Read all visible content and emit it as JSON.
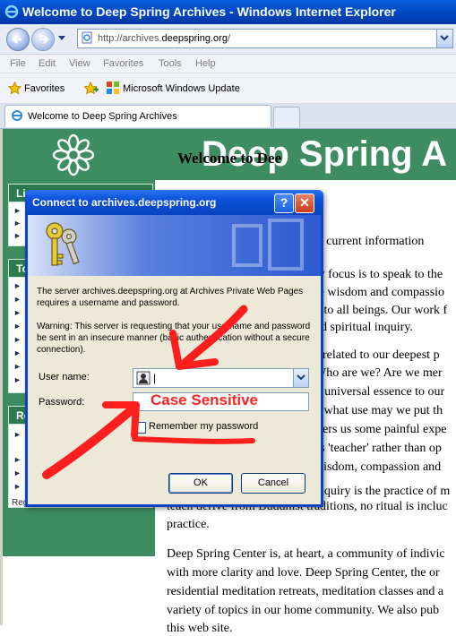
{
  "window": {
    "title": "Welcome to Deep Spring Archives - Windows Internet Explorer"
  },
  "address_bar": {
    "url_prefix": "http://archives.",
    "url_domain": "deepspring.org",
    "url_suffix": "/"
  },
  "menu": [
    "File",
    "Edit",
    "View",
    "Favorites",
    "Tools",
    "Help"
  ],
  "favorites_bar": {
    "favorites_label": "Favorites",
    "link": "Microsoft Windows Update"
  },
  "tab": {
    "title": "Welcome to Deep Spring Archives"
  },
  "site": {
    "banner_title": "Deep Spring A",
    "welcome": "Welcome to Dee",
    "sidebar": {
      "heading1": "Lin",
      "heading2": "To",
      "heading3": "Re",
      "register": "Register for a Class"
    },
    "body_lines": [
      "a. For current information",
      "ry focus is to speak to the",
      "re wisdom and compassio",
      "n to all beings. Our work f",
      "nd spiritual inquiry.",
      "s related to our deepest p",
      "Who are we? Are we mer",
      "r, universal essence to our",
      "o what use may we put th",
      "ffers us some painful expe",
      "as 'teacher' rather than op",
      "wisdom, compassion and",
      "inquiry is the practice of m",
      "teach derive from Buddhist traditions, no ritual is incluc",
      "practice.",
      "Deep Spring Center is, at heart, a community of indivic",
      "with more clarity and love. Deep Spring Center, the or",
      "residential meditation retreats, meditation classes and a",
      "variety of topics in our home community. We also pub",
      "this web site."
    ]
  },
  "dialog": {
    "title": "Connect to archives.deepspring.org",
    "help_label": "?",
    "close_label": "✕",
    "message": "The server archives.deepspring.org at Archives Private Web Pages requires a username and password.",
    "warning": "Warning: This server is requesting that your username and password be sent in an insecure manner (basic authentication without a secure connection).",
    "user_label": "User name:",
    "user_value": "|",
    "password_label": "Password:",
    "remember_label": "Remember my password",
    "remember_checked": false,
    "ok_label": "OK",
    "cancel_label": "Cancel"
  },
  "annotation": {
    "text": "Case  Sensitive",
    "color": "#ff1e1e"
  }
}
